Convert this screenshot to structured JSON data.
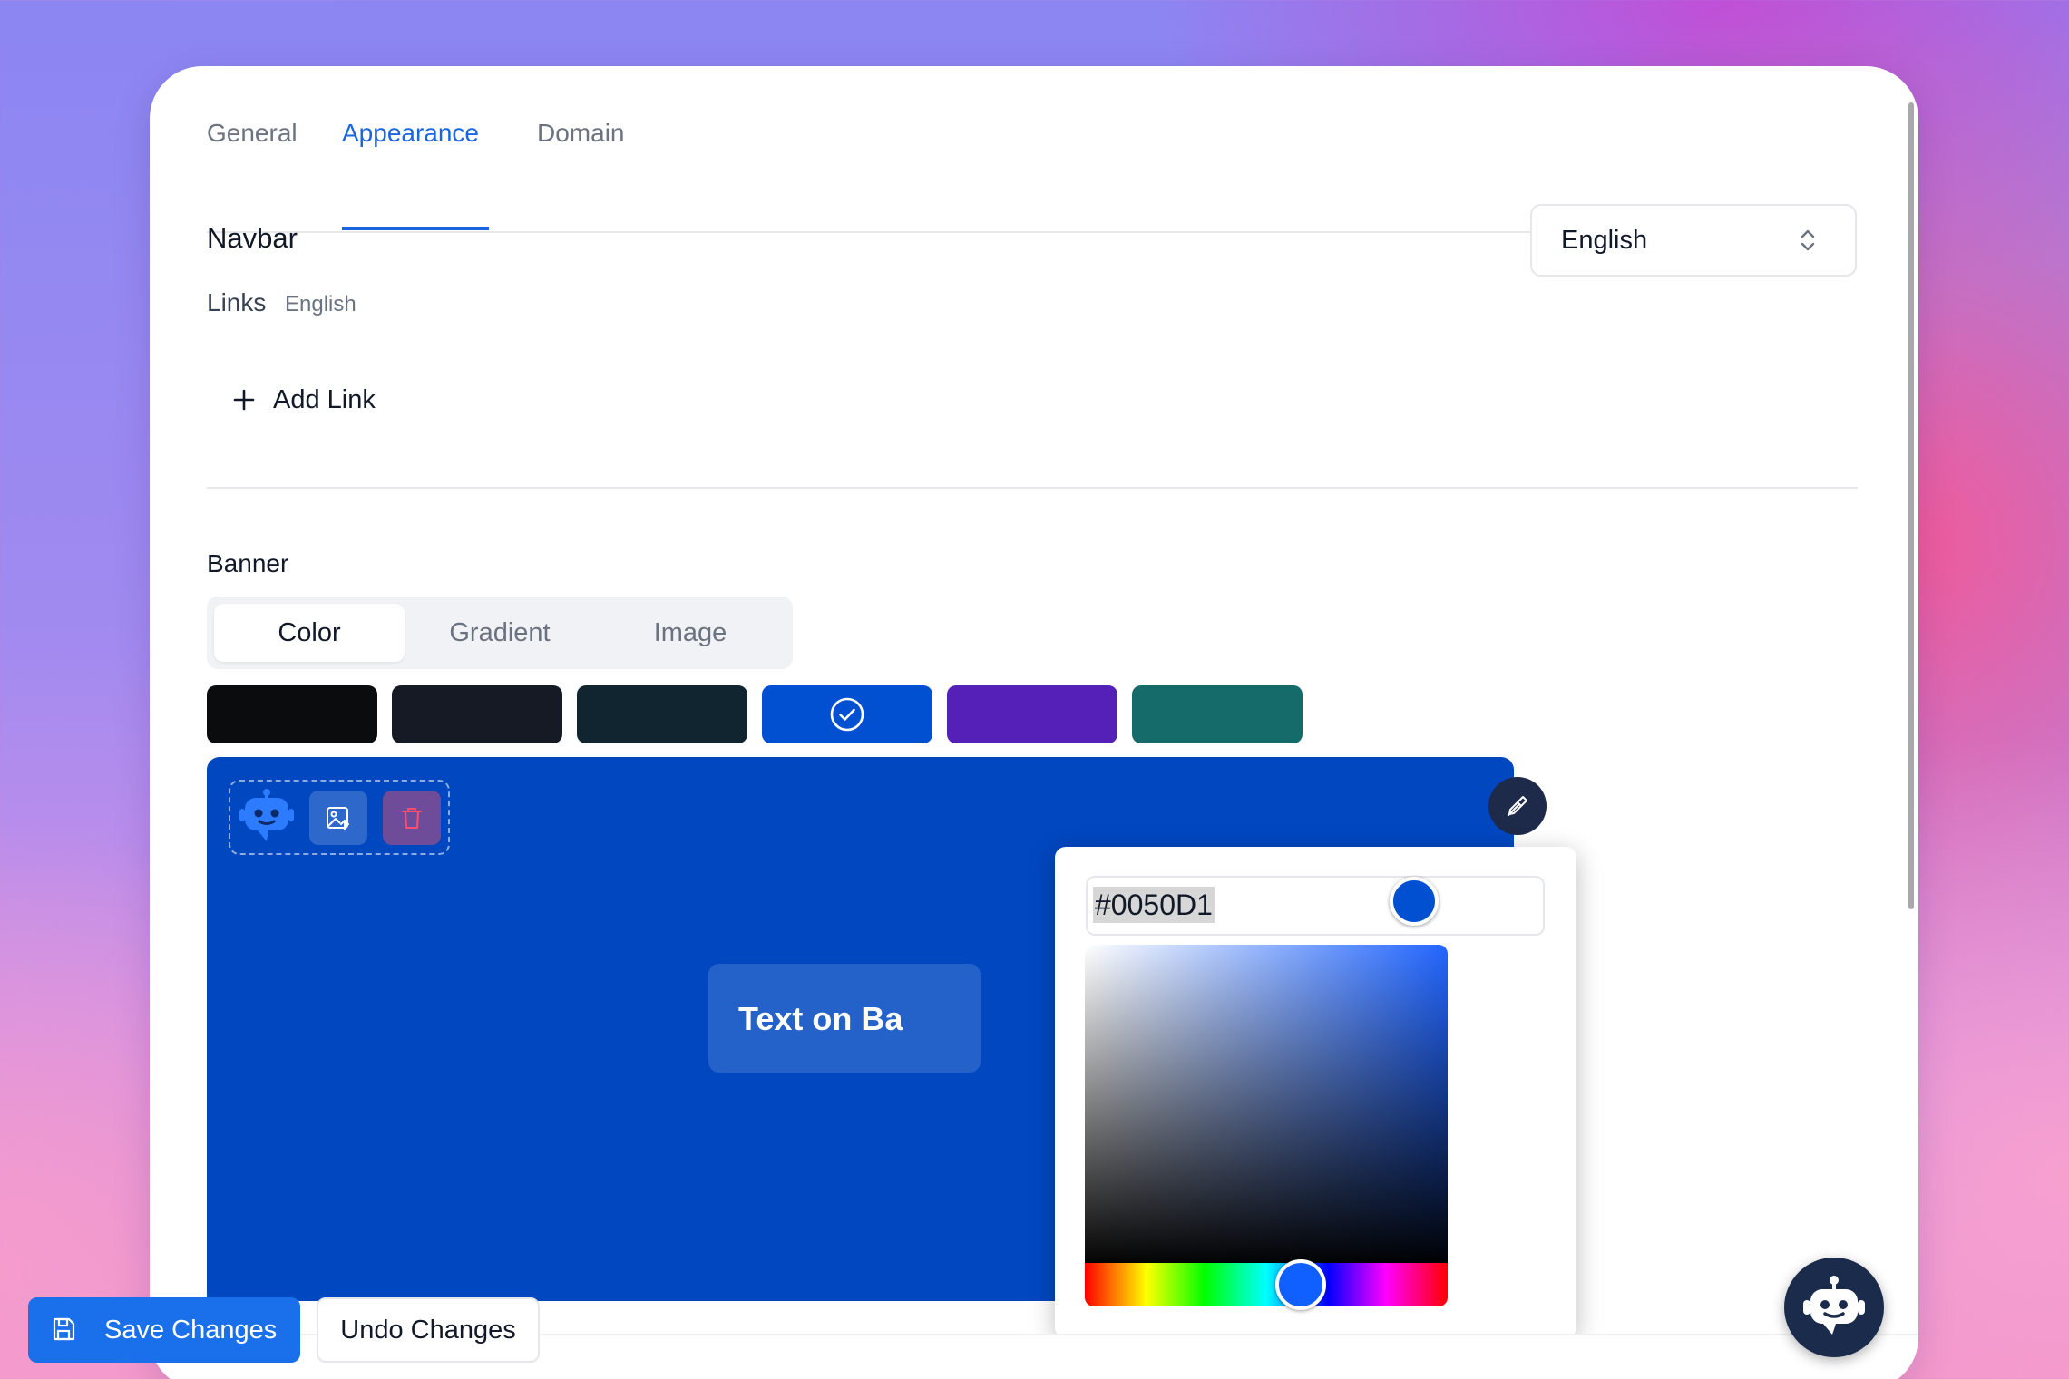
{
  "tabs": [
    {
      "label": "General",
      "active": false
    },
    {
      "label": "Appearance",
      "active": true
    },
    {
      "label": "Domain",
      "active": false
    }
  ],
  "navbar": {
    "title": "Navbar",
    "links_label": "Links",
    "links_language": "English",
    "add_link_label": "Add Link"
  },
  "language_select": {
    "value": "English",
    "icon": "chevron-up-down-icon"
  },
  "banner": {
    "title": "Banner",
    "modes": [
      {
        "label": "Color",
        "active": true
      },
      {
        "label": "Gradient",
        "active": false
      },
      {
        "label": "Image",
        "active": false
      }
    ],
    "swatches": [
      "#0b0c0e",
      "#161a24",
      "#112530",
      "#0050d1",
      "#5520b8",
      "#156a6a"
    ],
    "selected_swatch": "#0050d1",
    "background_color": "#0047c0",
    "preview_text": "Text on Ba",
    "tool_icons": [
      "bot-logo-icon",
      "image-upload-icon",
      "trash-icon"
    ]
  },
  "color_picker": {
    "hex_value": "#0050D1",
    "eyedropper_icon": "eyedropper-icon",
    "saturation": 0.97,
    "value": 0.88,
    "hue_position": 0.6
  },
  "footer": {
    "save_label": "Save Changes",
    "undo_label": "Undo Changes",
    "save_icon": "floppy-disk-icon"
  },
  "chat_bot_icon": "chat-bot-icon",
  "colors": {
    "accent": "#1a66e0",
    "save_button": "#1a6fea"
  }
}
